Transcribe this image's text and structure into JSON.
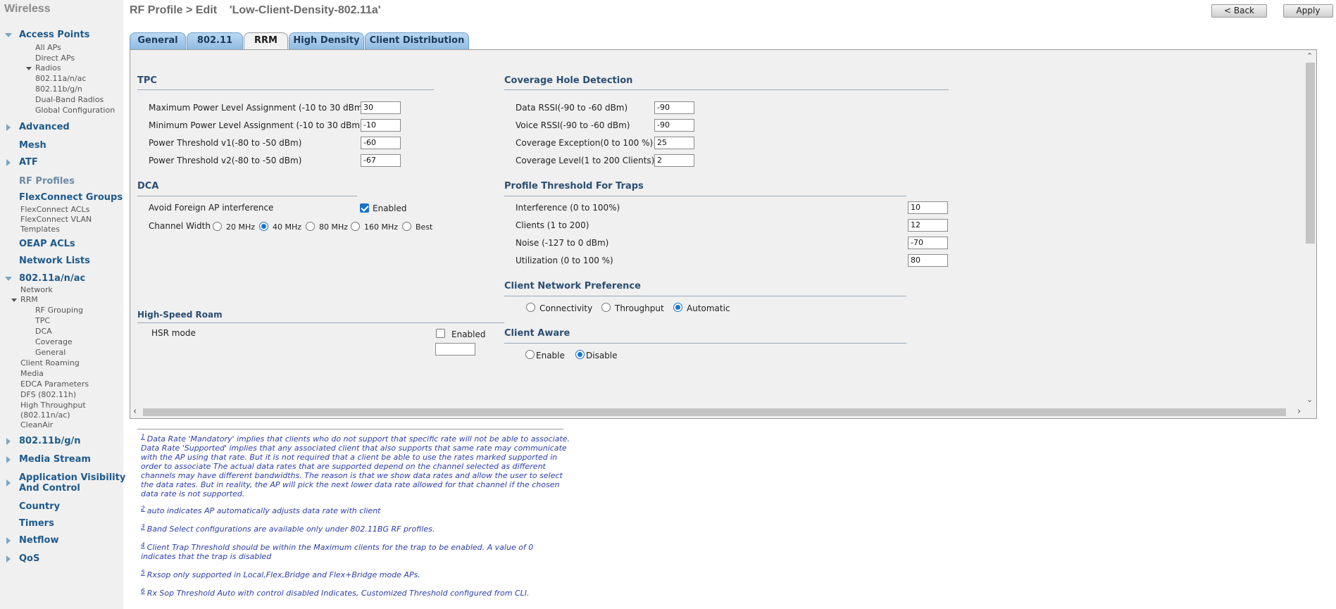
{
  "sidebar": {
    "title": "Wireless",
    "access_points": "Access Points",
    "all_aps": "All APs",
    "direct_aps": "Direct APs",
    "radios": "Radios",
    "radio_a": "802.11a/n/ac",
    "radio_b": "802.11b/g/n",
    "dual_band": "Dual-Band Radios",
    "global_config": "Global Configuration",
    "advanced": "Advanced",
    "mesh": "Mesh",
    "atf": "ATF",
    "rf_profiles": "RF Profiles",
    "flexconnect_groups": "FlexConnect Groups",
    "flexconnect_acls": "FlexConnect ACLs",
    "flexconnect_vlan_1": "FlexConnect VLAN",
    "flexconnect_vlan_2": "Templates",
    "oeap_acls": "OEAP ACLs",
    "network_lists": "Network Lists",
    "band_a": "802.11a/n/ac",
    "network": "Network",
    "rrm": "RRM",
    "rf_grouping": "RF Grouping",
    "tpc": "TPC",
    "dca": "DCA",
    "coverage": "Coverage",
    "general": "General",
    "client_roaming": "Client Roaming",
    "media": "Media",
    "edca": "EDCA Parameters",
    "dfs": "DFS (802.11h)",
    "ht_1": "High Throughput",
    "ht_2": "(802.11n/ac)",
    "cleanair": "CleanAir",
    "band_b": "802.11b/g/n",
    "media_stream": "Media Stream",
    "avc_1": "Application Visibility",
    "avc_2": "And Control",
    "country": "Country",
    "timers": "Timers",
    "netflow": "Netflow",
    "qos": "QoS"
  },
  "header": {
    "title": "RF Profile > Edit    'Low-Client-Density-802.11a'",
    "back_label": "< Back",
    "apply_label": "Apply"
  },
  "tabs": [
    "General",
    "802.11",
    "RRM",
    "High Density",
    "Client Distribution"
  ],
  "tpc": {
    "heading": "TPC",
    "max_label": "Maximum Power Level Assignment (-10 to 30 dBm)",
    "max_value": "30",
    "min_label": "Minimum Power Level Assignment (-10 to 30 dBm)",
    "min_value": "-10",
    "v1_label": "Power Threshold v1(-80 to -50 dBm)",
    "v1_value": "-60",
    "v2_label": "Power Threshold v2(-80 to -50 dBm)",
    "v2_value": "-67"
  },
  "dca": {
    "heading": "DCA",
    "avoid_label": "Avoid Foreign AP interference",
    "enabled_label": "Enabled",
    "channel_width_label": "Channel Width",
    "widths": [
      "20 MHz",
      "40 MHz",
      "80 MHz",
      "160 MHz",
      "Best"
    ],
    "selected_width": "40 MHz"
  },
  "coverage": {
    "heading": "Coverage Hole Detection",
    "data_rssi_label": "Data RSSI(-90 to -60 dBm)",
    "data_rssi_value": "-90",
    "voice_rssi_label": "Voice RSSI(-90 to -60 dBm)",
    "voice_rssi_value": "-90",
    "exception_label": "Coverage Exception(0 to 100 %)",
    "exception_value": "25",
    "level_label": "Coverage Level(1 to 200 Clients)",
    "level_value": "2"
  },
  "traps": {
    "heading": "Profile Threshold For Traps",
    "interference_label": "Interference (0 to 100%)",
    "interference_value": "10",
    "clients_label": "Clients (1 to 200)",
    "clients_value": "12",
    "noise_label": "Noise (-127 to 0 dBm)",
    "noise_value": "-70",
    "utilization_label": "Utilization (0 to 100 %)",
    "utilization_value": "80"
  },
  "network_pref": {
    "heading": "Client Network Preference",
    "options": [
      "Connectivity",
      "Throughput",
      "Automatic"
    ],
    "selected": "Automatic"
  },
  "client_aware": {
    "heading": "Client Aware",
    "enable_label": "Enable",
    "disable_label": "Disable",
    "selected": "Disable"
  },
  "hsr": {
    "heading": "High-Speed Roam",
    "mode_label": "HSR mode",
    "enabled_label": "Enabled",
    "enabled": false
  },
  "footnotes": [
    {
      "num": "1",
      "text": "Data Rate 'Mandatory' implies that clients who do not support that specific rate will not be able to associate. Data Rate 'Supported' implies that any associated client that also supports that same rate may communicate with the AP using that rate. But it is not required that a client be able to use the rates marked supported in order to associate The actual data rates that are supported depend on the channel selected as different channels may have different bandwidths. The reason is that we show data rates and allow the user to select the data rates. But in reality, the AP will pick the next lower data rate allowed for that channel if the chosen data rate is not supported."
    },
    {
      "num": "2",
      "text": "auto indicates AP automatically adjusts data rate with client"
    },
    {
      "num": "3",
      "text": "Band Select configurations are available only under 802.11BG RF profiles."
    },
    {
      "num": "4",
      "text": "Client Trap Threshold should be within the Maximum clients for the trap to be enabled. A value of 0 indicates that the trap is disabled"
    },
    {
      "num": "5",
      "text": "Rxsop only supported in Local,Flex,Bridge and Flex+Bridge mode APs."
    },
    {
      "num": "6",
      "text": "Rx Sop Threshold Auto with control disabled Indicates, Customized Threshold configured from CLI."
    }
  ],
  "colors": {
    "accent_blue": "#1a73c9",
    "nav_blue": "#1e5a8c",
    "tab_blue": "#8fbbe3",
    "footnote_blue": "#2a3fa8"
  },
  "icons": [
    "chevron-right-icon",
    "chevron-down-icon",
    "scroll-up-icon",
    "scroll-down-icon",
    "scroll-left-icon",
    "scroll-right-icon"
  ]
}
